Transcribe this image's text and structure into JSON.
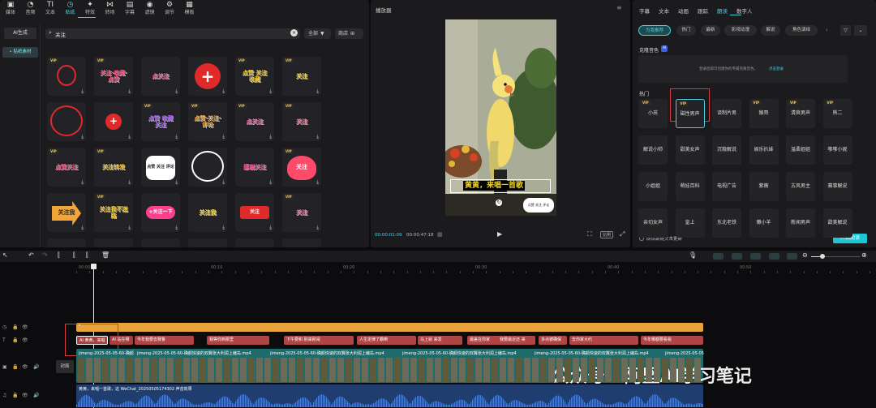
{
  "toolbar": [
    {
      "label": "媒体",
      "icon": "media-icon",
      "sym": "▣"
    },
    {
      "label": "音频",
      "icon": "audio-icon",
      "sym": "◔"
    },
    {
      "label": "文本",
      "icon": "text-icon",
      "sym": "TI"
    },
    {
      "label": "贴纸",
      "icon": "sticker-icon",
      "sym": "◷",
      "active": true
    },
    {
      "label": "特效",
      "icon": "effects-icon",
      "sym": "✦"
    },
    {
      "label": "转场",
      "icon": "transition-icon",
      "sym": "⋈"
    },
    {
      "label": "字幕",
      "icon": "caption-icon",
      "sym": "▤"
    },
    {
      "label": "滤镜",
      "icon": "filter-icon",
      "sym": "◉"
    },
    {
      "label": "调节",
      "icon": "adjust-icon",
      "sym": "⚙"
    },
    {
      "label": "模板",
      "icon": "template-icon",
      "sym": "▦"
    }
  ],
  "left_nav": {
    "ai": "AI生成",
    "material": "• 贴纸素材"
  },
  "search": {
    "value": "关注",
    "all": "全部",
    "collect": "商店"
  },
  "stickers": [
    {
      "vip": true,
      "t": "",
      "style": "ring-red-small"
    },
    {
      "vip": true,
      "t": "关注·收藏·点赞",
      "c": "#ff5a8a"
    },
    {
      "vip": false,
      "t": "点关注",
      "c": "#ff6fb1"
    },
    {
      "vip": false,
      "t": "+",
      "style": "plus-big"
    },
    {
      "vip": true,
      "t": "点赞 关注 收藏",
      "c": "#ffd33d"
    },
    {
      "vip": true,
      "t": "关注",
      "c": "#ffe14d"
    },
    {
      "vip": false,
      "t": "",
      "style": "ring-red"
    },
    {
      "vip": false,
      "t": "+",
      "style": "plus-small"
    },
    {
      "vip": true,
      "t": "点赞 收藏 关注",
      "c": "#b46bff"
    },
    {
      "vip": true,
      "t": "点赞·关注·评论",
      "c": "#ffb84d"
    },
    {
      "vip": true,
      "t": "点关注",
      "c": "#ff6fb1"
    },
    {
      "vip": true,
      "t": "关注",
      "c": "#ff7fa0"
    },
    {
      "vip": true,
      "t": "点赞关注",
      "c": "#ff5a8a"
    },
    {
      "vip": true,
      "t": "关注转发",
      "c": "#ffd33d"
    },
    {
      "vip": false,
      "t": "点赞 关注 评论",
      "style": "bubble"
    },
    {
      "vip": false,
      "t": "",
      "style": "ring-white"
    },
    {
      "vip": false,
      "t": "感谢关注",
      "c": "#ff5aa0"
    },
    {
      "vip": true,
      "t": "关注",
      "style": "heart"
    },
    {
      "vip": false,
      "t": "关注我",
      "style": "arrow"
    },
    {
      "vip": true,
      "t": "关注我不迷路",
      "c": "#ffd33d"
    },
    {
      "vip": false,
      "t": "+关注一下",
      "style": "pill-pink"
    },
    {
      "vip": false,
      "t": "关注我",
      "c": "#ffe14d"
    },
    {
      "vip": false,
      "t": "关注",
      "style": "pill-red"
    },
    {
      "vip": true,
      "t": "关注",
      "c": "#ff7fb1"
    }
  ],
  "player": {
    "title": "播放器",
    "caption": "黄黄，来唱一首歌",
    "time_current": "00:00:01:09",
    "time_total": "00:00:47:18",
    "ratio": "比例"
  },
  "right": {
    "tabs": [
      "字幕",
      "文本",
      "动画",
      "跟踪",
      "朗读",
      "数字人"
    ],
    "filters": [
      "为我推荐",
      "热门",
      "最新",
      "影视动漫",
      "解说",
      "角色演绎"
    ],
    "clone_label": "克隆音色",
    "clone_hint": "登录后即可创建你的专属克隆音色。",
    "clone_link": "点击登录",
    "hot_label": "热门",
    "voices": [
      {
        "t": "小孩",
        "vip": true
      },
      {
        "t": "磁性男声",
        "vip": true
      },
      {
        "t": "译制片男",
        "vip": false
      },
      {
        "t": "猴哥",
        "vip": true
      },
      {
        "t": "清爽男声",
        "vip": true
      },
      {
        "t": "熊二",
        "vip": true
      },
      {
        "t": "解说小帅",
        "vip": false
      },
      {
        "t": "甜美女声",
        "vip": false
      },
      {
        "t": "沉稳解说",
        "vip": false
      },
      {
        "t": "娱乐扒妹",
        "vip": false
      },
      {
        "t": "温柔姐姐",
        "vip": false
      },
      {
        "t": "嗲嗲小妮",
        "vip": false
      },
      {
        "t": "小姐姐",
        "vip": false
      },
      {
        "t": "萌娃百科",
        "vip": false
      },
      {
        "t": "电视广告",
        "vip": false
      },
      {
        "t": "紫薇",
        "vip": false
      },
      {
        "t": "古风男主",
        "vip": false
      },
      {
        "t": "赛事解说",
        "vip": false
      },
      {
        "t": "亲切女声",
        "vip": false
      },
      {
        "t": "皇上",
        "vip": false
      },
      {
        "t": "东北老铁",
        "vip": false
      },
      {
        "t": "懒小羊",
        "vip": false
      },
      {
        "t": "新闻男声",
        "vip": false
      },
      {
        "t": "甜美解说",
        "vip": false
      }
    ],
    "check_label": "朗读跟随文本更新",
    "start_btn": "开始朗读"
  },
  "ruler": [
    "00:00",
    "00:10",
    "00:20",
    "00:30",
    "00:40",
    "00:50"
  ],
  "captions": [
    "AI 黄黄，来唱",
    "AI 站在哪",
    "今年我要去赛鲁",
    "我等你到那里",
    "下午要和 别来耐闹",
    "人生定律了霸嗬",
    "马上就 来发",
    "最差在你家",
    "我要最近还 来",
    "多点被确保",
    "去你家大约",
    "今年哪都要看看"
  ],
  "video_clip": "jimeng-2025-05-05-60-确颜快速的双翼张大利润上编岛.mp4",
  "audio_clip": "黄黄，来唱一首歌，这    WeChat_20250505174302   声音效果",
  "cover_label": "封面",
  "watermark": "公众号 · 阿坚AI学习笔记"
}
